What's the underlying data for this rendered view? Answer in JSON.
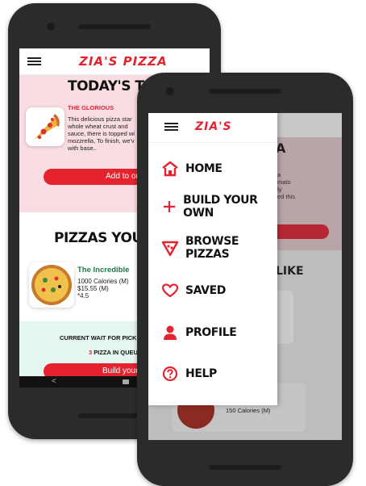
{
  "back_phone": {
    "brand": "ZIA'S PIZZA",
    "top_section": {
      "title": "TODAY'S TOP",
      "pizza_name": "THE GLORIOUS",
      "description": [
        "This delicious pizza star",
        "whole wheat crust and",
        "sauce, there is topped wi",
        "mozzrella, To finish, we'v",
        "with base.."
      ],
      "button": "Add to orde"
    },
    "middle_section": {
      "title": "PIZZAS YOU MIG",
      "pizza_name": "The Incredible",
      "calories": "1000 Calories (M)",
      "price": "$15.55 (M)",
      "rating": "*4.5"
    },
    "bottom_section": {
      "wait_label": "CURRENT WAIT FOR PICK",
      "queue_count": "3",
      "queue_text": " PIZZA IN QUEU",
      "button": "Build your ow"
    },
    "nav": {
      "back": "<"
    }
  },
  "front_phone": {
    "brand": "ZIA'S",
    "menu": [
      {
        "label": "HOME",
        "icon": "home-icon"
      },
      {
        "label": "BUILD YOUR OWN",
        "icon": "plus-icon"
      },
      {
        "label": "BROWSE PIZZAS",
        "icon": "pizza-slice-icon"
      },
      {
        "label": "SAVED",
        "icon": "heart-icon"
      },
      {
        "label": "PROFILE",
        "icon": "person-icon"
      },
      {
        "label": "HELP",
        "icon": "question-icon"
      }
    ],
    "background": {
      "title_fragment": "A",
      "desc_fragments": [
        "a",
        "mato",
        "ly",
        "ed this"
      ],
      "section2_fragment": "LIKE",
      "calories": "150 Calories (M)"
    }
  },
  "colors": {
    "accent": "#e4232f",
    "pink": "#f9dde2",
    "mint": "#e5f5ef"
  }
}
